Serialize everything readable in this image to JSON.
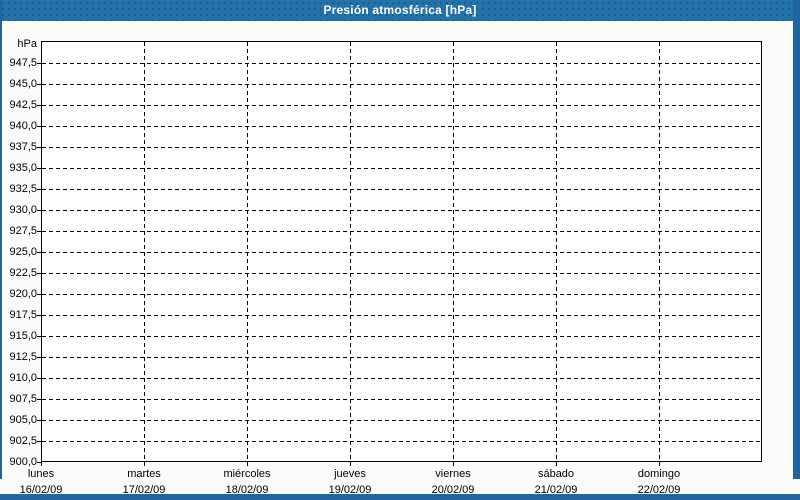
{
  "window": {
    "title": "Presión atmosférica [hPa]"
  },
  "chart_data": {
    "type": "line",
    "title": "Presión atmosférica [hPa]",
    "ylabel": "hPa",
    "unit": "hPa",
    "ylim": [
      900,
      950
    ],
    "y_tick_step": 2.5,
    "decimal_separator": ",",
    "y_tick_labels": [
      "947,5",
      "945,0",
      "942,5",
      "940,0",
      "937,5",
      "935,0",
      "932,5",
      "930,0",
      "927,5",
      "925,0",
      "922,5",
      "920,0",
      "917,5",
      "915,0",
      "912,5",
      "910,0",
      "907,5",
      "905,0",
      "902,5",
      "900,0"
    ],
    "y_tick_values": [
      947.5,
      945.0,
      942.5,
      940.0,
      937.5,
      935.0,
      932.5,
      930.0,
      927.5,
      925.0,
      922.5,
      920.0,
      917.5,
      915.0,
      912.5,
      910.0,
      907.5,
      905.0,
      902.5,
      900.0
    ],
    "x_categories": [
      {
        "day": "lunes",
        "date": "16/02/09"
      },
      {
        "day": "martes",
        "date": "17/02/09"
      },
      {
        "day": "miércoles",
        "date": "18/02/09"
      },
      {
        "day": "jueves",
        "date": "19/02/09"
      },
      {
        "day": "viernes",
        "date": "20/02/09"
      },
      {
        "day": "sábado",
        "date": "21/02/09"
      },
      {
        "day": "domingo",
        "date": "22/02/09"
      }
    ],
    "series": [],
    "grid": "dashed",
    "legend": "none",
    "colors": {
      "title_bar": "#2472aa",
      "frame_border": "#2165a0",
      "grid_line": "#000000",
      "plot_background": "#ffffff",
      "page_background": "#fbfcfa",
      "title_text": "#ffffff",
      "label_text": "#000000"
    }
  }
}
